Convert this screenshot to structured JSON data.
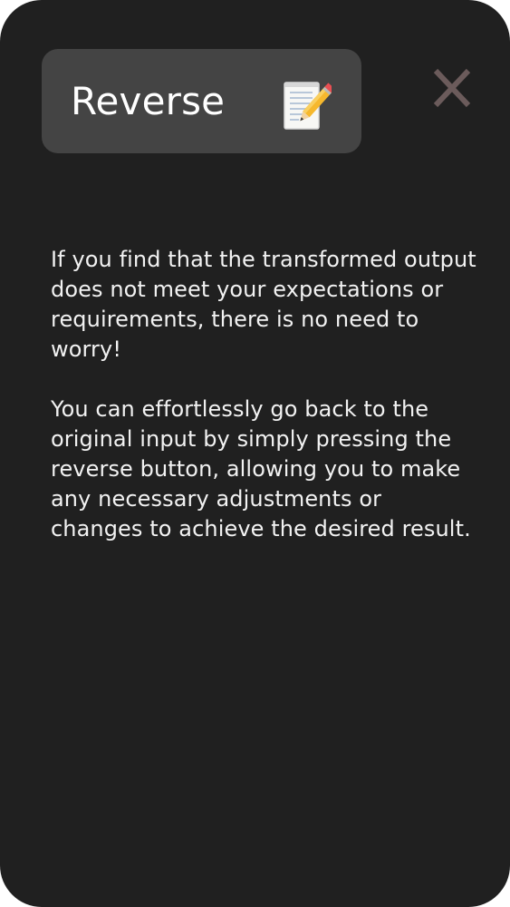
{
  "dialog": {
    "title": "Reverse",
    "title_icon": "memo-pencil-icon",
    "close_icon": "close-icon",
    "paragraphs": [
      "If you find that the transformed output does not meet your expectations or requirements, there is no need to worry!",
      "You can effortlessly go back to the original input by simply pressing the reverse button, allowing you to make any necessary adjustments or changes to achieve the desired result."
    ]
  },
  "colors": {
    "panel_background": "#202020",
    "title_pill_background": "#444444",
    "text": "#ffffff",
    "close_icon": "#6b5b5b"
  }
}
